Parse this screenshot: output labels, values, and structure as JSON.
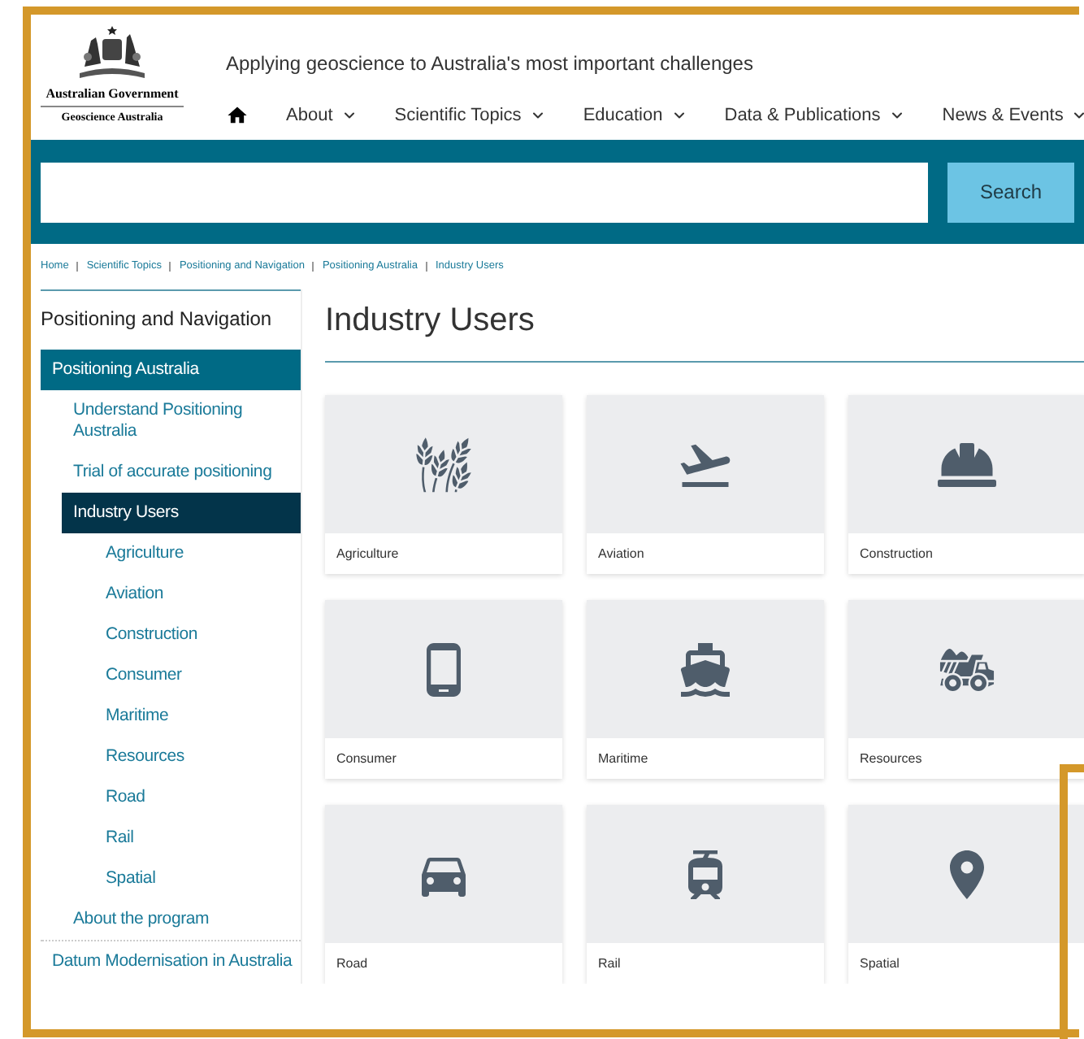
{
  "header": {
    "logo": {
      "line_1": "Australian Government",
      "line_2": "Geoscience Australia"
    },
    "tagline": "Applying geoscience to Australia's most important challenges"
  },
  "nav": [
    {
      "kind": "home"
    },
    {
      "kind": "menu",
      "label": "About"
    },
    {
      "kind": "menu",
      "label": "Scientific Topics"
    },
    {
      "kind": "menu",
      "label": "Education"
    },
    {
      "kind": "menu",
      "label": "Data & Publications"
    },
    {
      "kind": "menu",
      "label": "News & Events"
    }
  ],
  "search": {
    "button": "Search"
  },
  "breadcrumb": [
    "Home",
    "Scientific Topics",
    "Positioning and Navigation",
    "Positioning Australia",
    "Industry Users"
  ],
  "sidebar": {
    "title": "Positioning and Navigation",
    "items": [
      {
        "label": "Positioning Australia",
        "expanded": true,
        "selected": false,
        "children": [
          {
            "label": "Understand Positioning Australia",
            "selected": false
          },
          {
            "label": "Trial of accurate positioning",
            "selected": false
          },
          {
            "label": "Industry Users",
            "selected": true,
            "children": [
              {
                "label": "Agriculture",
                "selected": false
              },
              {
                "label": "Aviation",
                "selected": false
              },
              {
                "label": "Construction",
                "selected": false
              },
              {
                "label": "Consumer",
                "selected": false
              },
              {
                "label": "Maritime",
                "selected": false
              },
              {
                "label": "Resources",
                "selected": false
              },
              {
                "label": "Road",
                "selected": false
              },
              {
                "label": "Rail",
                "selected": false
              },
              {
                "label": "Spatial",
                "selected": false
              }
            ]
          },
          {
            "label": "About the program",
            "selected": false
          }
        ]
      },
      {
        "label": "Datum Modernisation in Australia",
        "expanded": false,
        "selected": false
      }
    ]
  },
  "main": {
    "title": "Industry Users",
    "cards": [
      {
        "label": "Agriculture"
      },
      {
        "label": "Aviation"
      },
      {
        "label": "Construction"
      },
      {
        "label": "Consumer"
      },
      {
        "label": "Maritime"
      },
      {
        "label": "Resources"
      },
      {
        "label": "Road"
      },
      {
        "label": "Rail"
      },
      {
        "label": "Spatial"
      }
    ]
  }
}
